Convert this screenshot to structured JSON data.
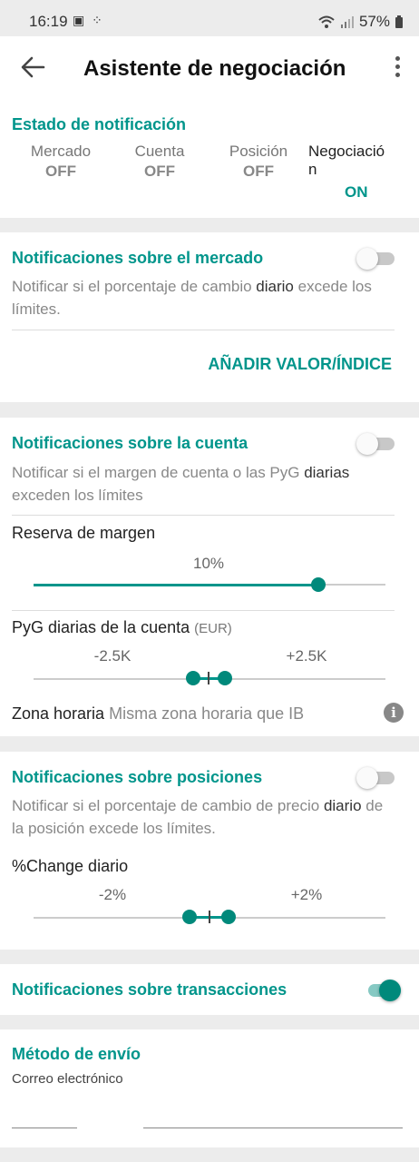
{
  "status_bar": {
    "time": "16:19",
    "battery": "57%"
  },
  "header": {
    "title": "Asistente de negociación"
  },
  "notification_status": {
    "heading": "Estado de notificación",
    "items": [
      {
        "name": "Mercado",
        "state": "OFF"
      },
      {
        "name": "Cuenta",
        "state": "OFF"
      },
      {
        "name": "Posición",
        "state": "OFF"
      },
      {
        "name_line1": "Negociació",
        "name_line2": "n",
        "state": "ON"
      }
    ]
  },
  "market": {
    "heading": "Notificaciones sobre el mercado",
    "desc_a": "Notificar si el porcentaje de cambio ",
    "desc_b": "diario",
    "desc_c": " excede los límites.",
    "toggle": "off",
    "add_label": "AÑADIR VALOR/ÍNDICE"
  },
  "account": {
    "heading": "Notificaciones sobre la cuenta",
    "desc_a": "Notificar si el margen de cuenta o las PyG ",
    "desc_b": "diarias",
    "desc_c": " exceden los límites",
    "toggle": "off",
    "margin_label": "Reserva de margen",
    "margin_value": "10%",
    "margin_fraction": 0.81,
    "pnl_label": "PyG diarias de la cuenta",
    "pnl_currency": "(EUR)",
    "pnl_low": "-2.5K",
    "pnl_high": "+2.5K",
    "timezone_label": "Zona horaria",
    "timezone_value": "Misma zona horaria que IB"
  },
  "positions": {
    "heading": "Notificaciones sobre posiciones",
    "desc_a": "Notificar si el porcentaje de cambio de precio ",
    "desc_b": "diario",
    "desc_c": " de la posición excede los límites.",
    "toggle": "off",
    "change_label": "%Change diario",
    "change_low": "-2%",
    "change_high": "+2%"
  },
  "transactions": {
    "heading": "Notificaciones sobre transacciones",
    "toggle": "on"
  },
  "delivery": {
    "heading": "Método de envío",
    "value": "Correo electrónico"
  },
  "colors": {
    "accent": "#00958b",
    "toggle_on": "#00897b"
  }
}
